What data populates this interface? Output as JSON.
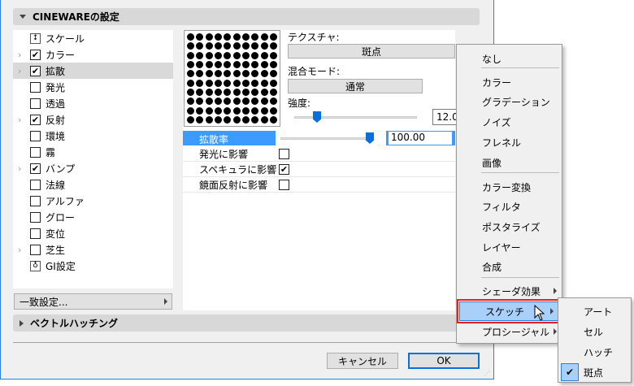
{
  "sections": {
    "cineware": "CINEWAREの設定",
    "vector_hatching": "ベクトルハッチング"
  },
  "channels": [
    {
      "label": "スケール",
      "icon": "scale-icon",
      "checkbox": null,
      "expandable": false
    },
    {
      "label": "カラー",
      "checkbox": true,
      "expandable": true
    },
    {
      "label": "拡散",
      "checkbox": true,
      "expandable": true,
      "selected": true
    },
    {
      "label": "発光",
      "checkbox": false,
      "expandable": false
    },
    {
      "label": "透過",
      "checkbox": false,
      "expandable": false
    },
    {
      "label": "反射",
      "checkbox": true,
      "expandable": true
    },
    {
      "label": "環境",
      "checkbox": false,
      "expandable": false
    },
    {
      "label": "霧",
      "checkbox": false,
      "expandable": false
    },
    {
      "label": "バンプ",
      "checkbox": true,
      "expandable": true
    },
    {
      "label": "法線",
      "checkbox": false,
      "expandable": false
    },
    {
      "label": "アルファ",
      "checkbox": false,
      "expandable": false
    },
    {
      "label": "グロー",
      "checkbox": false,
      "expandable": false
    },
    {
      "label": "変位",
      "checkbox": false,
      "expandable": false
    },
    {
      "label": "芝生",
      "checkbox": false,
      "expandable": true
    },
    {
      "label": "GI設定",
      "icon": "gi-icon",
      "checkbox": null,
      "expandable": false
    }
  ],
  "match_settings": "一致設定...",
  "texture": {
    "label": "テクスチャ:",
    "value": "斑点"
  },
  "blend": {
    "label": "混合モード:",
    "value": "通常"
  },
  "strength": {
    "label": "強度:",
    "value": "12.0",
    "slider_fraction": 0.12
  },
  "diffuse_rate": {
    "label": "拡散率",
    "value": "100.00",
    "slider_fraction": 1.0
  },
  "options": [
    {
      "label": "発光に影響",
      "checked": false
    },
    {
      "label": "スペキュラに影響",
      "checked": true
    },
    {
      "label": "鏡面反射に影響",
      "checked": false
    }
  ],
  "buttons": {
    "cancel": "キャンセル",
    "ok": "OK"
  },
  "menu": {
    "items": [
      "なし",
      "カラー",
      "グラデーション",
      "ノイズ",
      "フレネル",
      "画像",
      "カラー変換",
      "フィルタ",
      "ポスタライズ",
      "レイヤー",
      "合成",
      "シェーダ効果",
      "スケッチ",
      "プロシージャル"
    ]
  },
  "submenu": {
    "items": [
      "アート",
      "セル",
      "ハッチ",
      "斑点"
    ],
    "checked": "斑点"
  },
  "colors": {
    "accent": "#2b7fd8",
    "selection": "#3c9bff",
    "highlight": "#a8d0f8",
    "outline": "#e82020"
  }
}
